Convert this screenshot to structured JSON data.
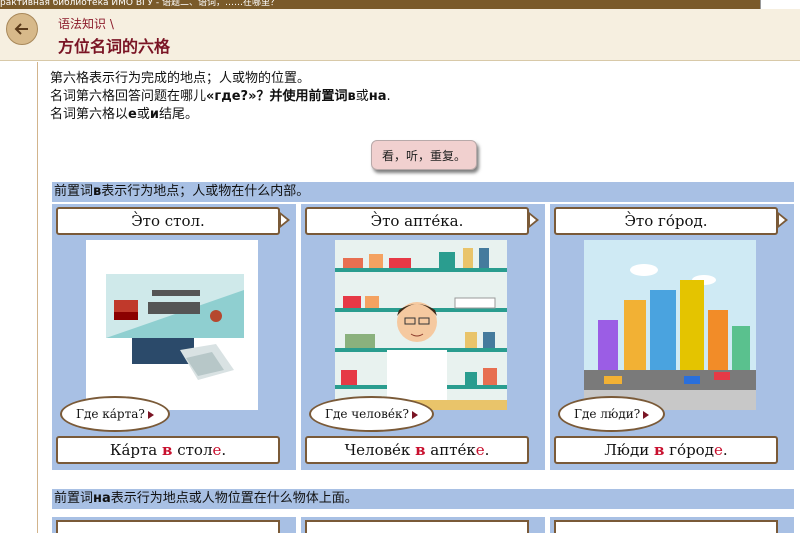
{
  "window": {
    "title": "рактивная библиотека ИМО ВГУ  -  语题二、语词，……在哪里？"
  },
  "header": {
    "breadcrumb": "语法知识 \\",
    "title": "方位名词的六格"
  },
  "intro": {
    "line1": "第六格表示行为完成的地点；人或物的位置。",
    "line2_a": "名词第六格回答问题在哪儿",
    "line2_b": "«где?»",
    "line2_c": "？并使用前置词",
    "line2_d": "в",
    "line2_e": "或",
    "line2_f": "на",
    "line2_g": ".",
    "line3_a": "名词第六格以",
    "line3_b": "е",
    "line3_c": "或",
    "line3_d": "и",
    "line3_e": "结尾。"
  },
  "listen_button": "看，听，重复。",
  "section1": {
    "pre": "前置词",
    "word": "в",
    "post": "表示行为地点；人或物在什么内部。"
  },
  "section2": {
    "pre": "前置词",
    "word": "на",
    "post": "表示行为地点或人物位置在什么物体上面。"
  },
  "cards": [
    {
      "label": "Э̀то стол.",
      "question": "Где ка́рта?",
      "ans_a": "Ка́рта ",
      "ans_prep": "в",
      "ans_b": " стол",
      "ans_end": "е",
      "ans_c": "."
    },
    {
      "label": "Э̀то апте́ка.",
      "question": "Где челове́к?",
      "ans_a": "Челове́к ",
      "ans_prep": "в",
      "ans_b": " апте́к",
      "ans_end": "е",
      "ans_c": "."
    },
    {
      "label": "Э̀то го́род.",
      "question": "Где лю́ди?",
      "ans_a": "Лю́ди ",
      "ans_prep": "в",
      "ans_b": " го́род",
      "ans_end": "е",
      "ans_c": "."
    }
  ],
  "colors": {
    "accent": "#7a1424",
    "bar": "#a8c0e4",
    "highlight": "#c8102e"
  }
}
